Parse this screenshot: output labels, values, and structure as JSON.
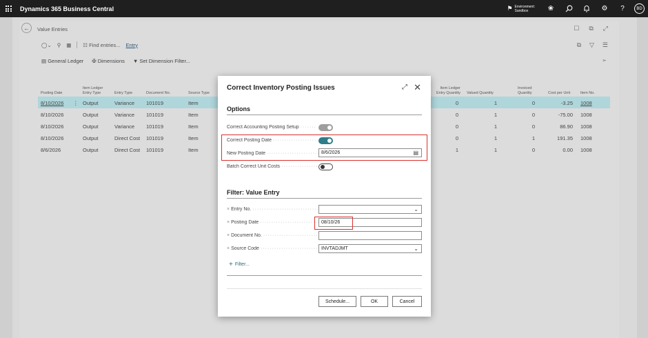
{
  "app": {
    "title": "Dynamics 365 Business Central",
    "environment_label": "Environment:",
    "environment_name": "Sandbox",
    "avatar_initials": "BD"
  },
  "page": {
    "title": "Value Entries",
    "actions": {
      "find_entries": "Find entries...",
      "entry_tab": "Entry",
      "general_ledger": "General Ledger",
      "dimensions": "Dimensions",
      "set_dimension_filter": "Set Dimension Filter..."
    }
  },
  "table": {
    "headers": {
      "posting_date": "Posting Date",
      "item_ledger_entry_type_1": "Item Ledger",
      "item_ledger_entry_type_2": "Entry Type",
      "entry_type": "Entry Type",
      "document_no": "Document No.",
      "source_type": "Source Type",
      "item_ledger_entry_qty_1": "Item Ledger",
      "item_ledger_entry_qty_2": "Entry Quantity",
      "valued_quantity": "Valued Quantity",
      "invoiced_quantity_1": "Invoiced",
      "invoiced_quantity_2": "Quantity",
      "cost_per_unit": "Cost per Unit",
      "item_no": "Item No."
    },
    "rows": [
      {
        "posting_date": "8/10/2026",
        "il_entry_type": "Output",
        "entry_type": "Variance",
        "document_no": "101019",
        "source_type": "Item",
        "il_entry_qty": "0",
        "valued_qty": "1",
        "invoiced_qty": "0",
        "cost_per_unit": "-3.25",
        "item_no": "1008"
      },
      {
        "posting_date": "8/10/2026",
        "il_entry_type": "Output",
        "entry_type": "Variance",
        "document_no": "101019",
        "source_type": "Item",
        "il_entry_qty": "0",
        "valued_qty": "1",
        "invoiced_qty": "0",
        "cost_per_unit": "-75.00",
        "item_no": "1008"
      },
      {
        "posting_date": "8/10/2026",
        "il_entry_type": "Output",
        "entry_type": "Variance",
        "document_no": "101019",
        "source_type": "Item",
        "il_entry_qty": "0",
        "valued_qty": "1",
        "invoiced_qty": "0",
        "cost_per_unit": "86.90",
        "item_no": "1008"
      },
      {
        "posting_date": "8/10/2026",
        "il_entry_type": "Output",
        "entry_type": "Direct Cost",
        "document_no": "101019",
        "source_type": "Item",
        "il_entry_qty": "0",
        "valued_qty": "1",
        "invoiced_qty": "1",
        "cost_per_unit": "191.35",
        "item_no": "1008"
      },
      {
        "posting_date": "8/6/2026",
        "il_entry_type": "Output",
        "entry_type": "Direct Cost",
        "document_no": "101019",
        "source_type": "Item",
        "il_entry_qty": "1",
        "valued_qty": "1",
        "invoiced_qty": "0",
        "cost_per_unit": "0.00",
        "item_no": "1008"
      }
    ]
  },
  "dialog": {
    "title": "Correct Inventory Posting Issues",
    "options_title": "Options",
    "correct_accounting_label": "Correct Accounting Posting Setup",
    "correct_posting_date_label": "Correct Posting Date",
    "new_posting_date_label": "New Posting Date",
    "new_posting_date_value": "8/6/2026",
    "batch_correct_label": "Batch Correct Unit Costs",
    "filter_title": "Filter: Value Entry",
    "filters": {
      "entry_no_label": "Entry No.",
      "entry_no_value": "",
      "posting_date_label": "Posting Date",
      "posting_date_value": "08/10/26",
      "document_no_label": "Document No.",
      "document_no_value": "",
      "source_code_label": "Source Code",
      "source_code_value": "INVTADJMT"
    },
    "add_filter": "Filter...",
    "buttons": {
      "schedule": "Schedule...",
      "ok": "OK",
      "cancel": "Cancel"
    }
  },
  "colors": {
    "appbar": "#1f1f1f",
    "selected_row": "#aed6db",
    "toggle_on": "#2e7d8a",
    "highlight": "#d9302c"
  }
}
